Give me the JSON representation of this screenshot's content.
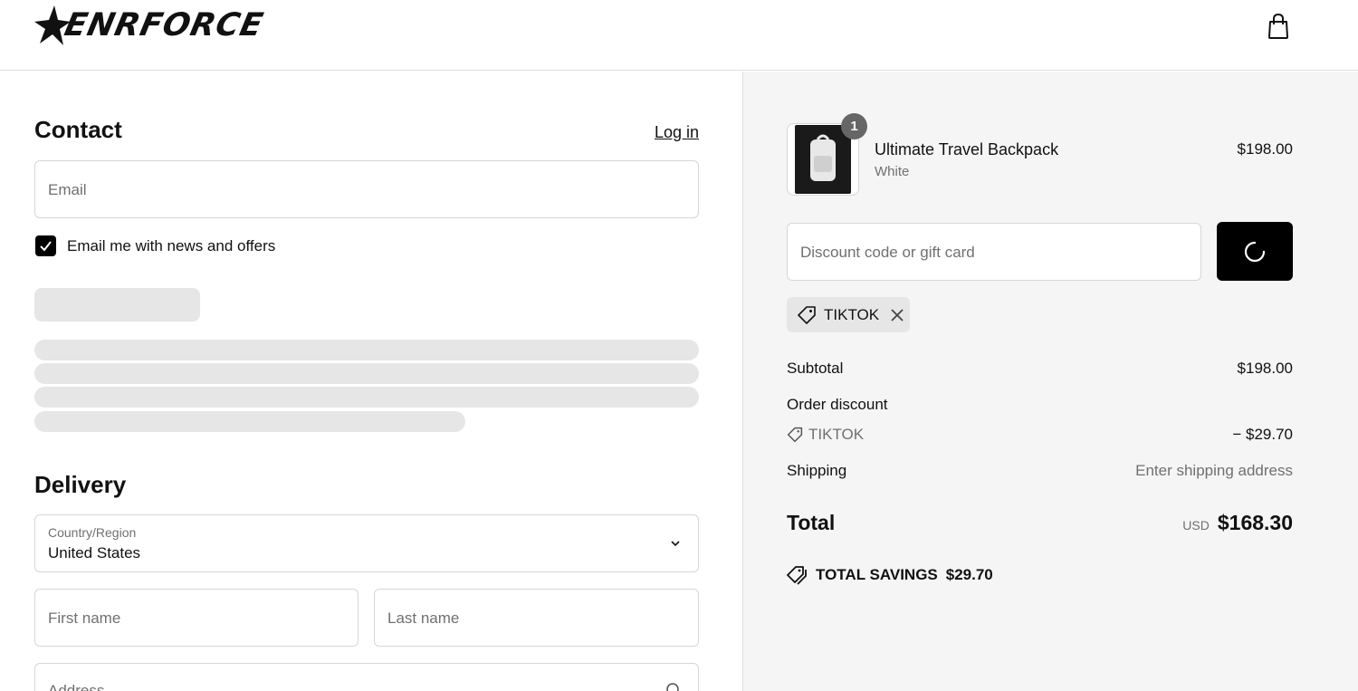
{
  "header": {
    "brand": "ENRFORCE",
    "cart_icon": "shopping-bag-icon"
  },
  "contact": {
    "title": "Contact",
    "login_link": "Log in",
    "email_placeholder": "Email",
    "newsletter_label": "Email me with news and offers",
    "newsletter_checked": true
  },
  "delivery": {
    "title": "Delivery",
    "country_label": "Country/Region",
    "country_value": "United States",
    "first_name_placeholder": "First name",
    "last_name_placeholder": "Last name",
    "address_placeholder": "Address"
  },
  "order": {
    "item": {
      "name": "Ultimate Travel Backpack",
      "variant": "White",
      "price": "$198.00",
      "quantity": "1"
    },
    "discount_placeholder": "Discount code or gift card",
    "applied_code": "TIKTOK",
    "subtotal_label": "Subtotal",
    "subtotal_value": "$198.00",
    "order_discount_label": "Order discount",
    "discount_code": "TIKTOK",
    "discount_value": "− $29.70",
    "shipping_label": "Shipping",
    "shipping_value": "Enter shipping address",
    "total_label": "Total",
    "total_currency": "USD",
    "total_value": "$168.30",
    "savings_label": "TOTAL SAVINGS",
    "savings_value": "$29.70"
  },
  "colors": {
    "accent": "#000000",
    "summary_bg": "#f5f5f5",
    "skeleton": "#e6e6e6",
    "muted_text": "#707070"
  }
}
